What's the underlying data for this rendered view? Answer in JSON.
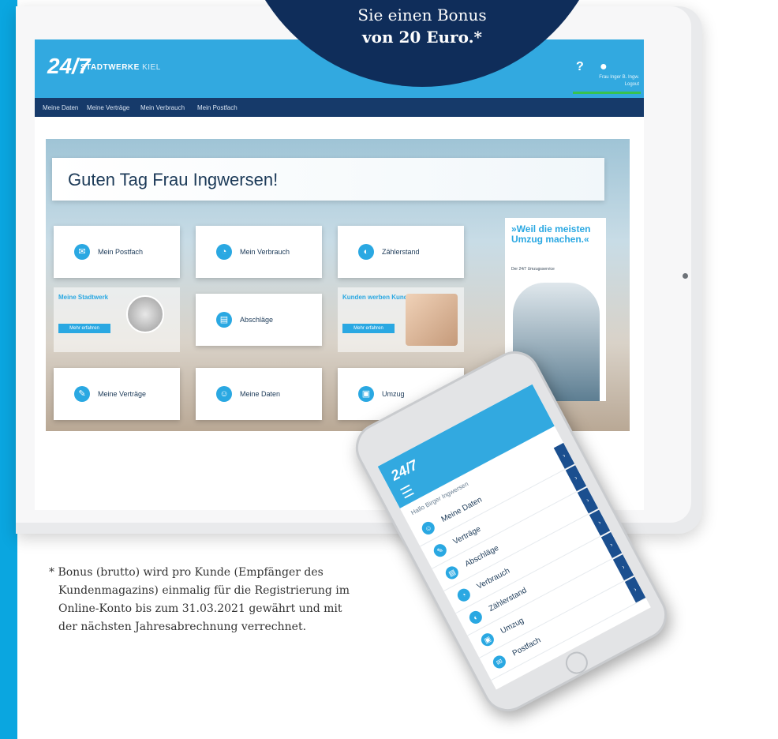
{
  "promo": {
    "line1": "Sie einen Bonus",
    "line2": "von 20 Euro.*"
  },
  "tablet_header": {
    "logo": "24/7",
    "brand": "STADTWERKE",
    "brand_suffix": "KIEL",
    "help_icon": "?",
    "user_icon": "user-icon",
    "user_info_line1": "Frau Inger B. Ingw.",
    "user_info_line2": "Logout"
  },
  "tablet_nav": [
    "Meine Daten",
    "Meine Verträge",
    "Mein Verbrauch",
    "Mein Postfach"
  ],
  "greeting": "Guten Tag Frau Ingwersen!",
  "tiles": {
    "postfach": "Mein Postfach",
    "verbrauch": "Mein Verbrauch",
    "zaehlerstand": "Zählerstand",
    "abschlaege": "Abschläge",
    "vertraege": "Meine Verträge",
    "daten": "Meine Daten",
    "umzug": "Umzug"
  },
  "promo_tiles": {
    "stadtwerk_title": "Meine Stadtwerk",
    "stadtwerk_btn": "Mehr erfahren",
    "kunden_title": "Kunden werben Kunden",
    "kunden_btn": "Mehr erfahren"
  },
  "side_ad": {
    "quote": "»Weil die meisten Umzug machen.«",
    "sub": "Der 24/7 Umzugsservice"
  },
  "phone": {
    "logo": "24/7",
    "hello": "Hallo Birger Ingwersen",
    "menu": [
      "Meine Daten",
      "Verträge",
      "Abschläge",
      "Verbrauch",
      "Zählerstand",
      "Umzug",
      "Postfach"
    ]
  },
  "footnote": {
    "line1": "* Bonus (brutto) wird pro Kunde (Empfänger des",
    "line2": "Kundenmagazins) einmalig für die Registrierung im",
    "line3": "Online-Konto bis zum 31.03.2021 gewährt und mit",
    "line4": "der nächsten Jahresabrechnung verrechnet."
  }
}
